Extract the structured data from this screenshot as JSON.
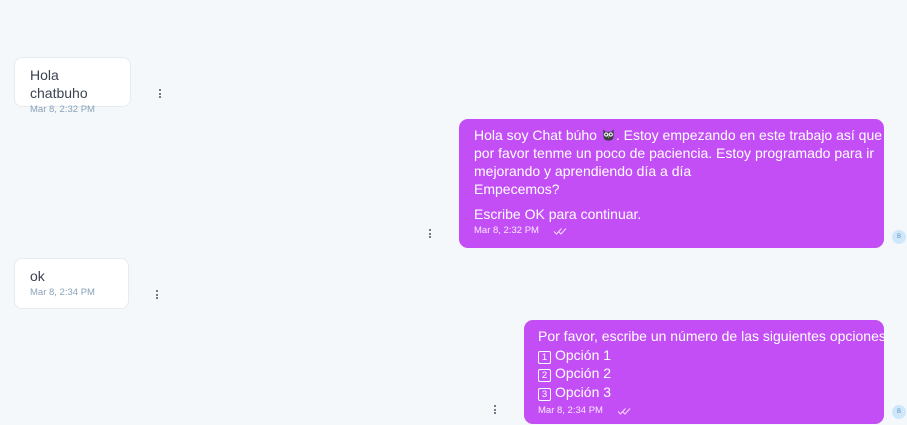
{
  "messages": [
    {
      "from": "user",
      "text": "Hola chatbuho",
      "time": "Mar 8, 2:32 PM"
    },
    {
      "from": "bot",
      "lines": [
        "Hola soy Chat búho",
        ". Estoy empezando en este trabajo así que",
        "por favor tenme un poco de paciencia. Estoy programado para ir",
        "mejorando y aprendiendo día a día",
        "Empecemos?",
        "Escribe OK para continuar."
      ],
      "emoji_icon": "owl-emoji-icon",
      "time": "Mar 8, 2:32 PM",
      "avatar": "B"
    },
    {
      "from": "user",
      "text": "ok",
      "time": "Mar 8, 2:34 PM"
    },
    {
      "from": "bot",
      "title": "Por favor, escribe un número de las siguientes opciones",
      "options": [
        {
          "key": "1",
          "label": "Opción 1"
        },
        {
          "key": "2",
          "label": "Opción 2"
        },
        {
          "key": "3",
          "label": "Opción 3"
        }
      ],
      "time": "Mar 8, 2:34 PM",
      "avatar": "B"
    }
  ],
  "colors": {
    "background": "#f5f8fb",
    "bot_bubble": "#c34ef5",
    "user_bubble": "#ffffff",
    "timestamp_user": "#8aa2b8",
    "avatar_bg": "#cfe7fb"
  },
  "icons": {
    "menu": "more-vertical-icon",
    "read_receipt": "double-check-icon",
    "emoji": "owl-emoji-icon"
  }
}
